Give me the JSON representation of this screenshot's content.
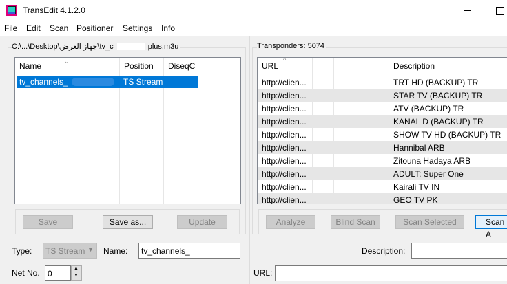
{
  "window": {
    "title": "TransEdit 4.1.2.0"
  },
  "menu": [
    "File",
    "Edit",
    "Scan",
    "Positioner",
    "Settings",
    "Info"
  ],
  "left_panel": {
    "path": "C:\\...\\Desktop\\جهاز العرض\\tv_c",
    "path_suffix": "plus.m3u",
    "columns": [
      "Name",
      "Position",
      "DiseqC"
    ],
    "rows": [
      {
        "name": "tv_channels_",
        "position": "TS Stream",
        "diseqc": ""
      }
    ],
    "buttons": {
      "save": "Save",
      "save_as": "Save as...",
      "update": "Update"
    },
    "type_label": "Type:",
    "type_value": "TS Stream",
    "name_label": "Name:",
    "name_value": "tv_channels_",
    "netno_label": "Net No.",
    "netno_value": "0"
  },
  "right_panel": {
    "label": "Transponders: 5074",
    "columns": [
      "URL",
      "Description"
    ],
    "rows": [
      {
        "url": "http://clien...",
        "desc": "TRT HD (BACKUP) TR"
      },
      {
        "url": "http://clien...",
        "desc": "STAR TV (BACKUP) TR"
      },
      {
        "url": "http://clien...",
        "desc": "ATV (BACKUP) TR"
      },
      {
        "url": "http://clien...",
        "desc": "KANAL D (BACKUP) TR"
      },
      {
        "url": "http://clien...",
        "desc": "SHOW TV HD (BACKUP) TR"
      },
      {
        "url": "http://clien...",
        "desc": "Hannibal ARB"
      },
      {
        "url": "http://clien...",
        "desc": "Zitouna Hadaya ARB"
      },
      {
        "url": "http://clien...",
        "desc": "ADULT: Super One"
      },
      {
        "url": "http://clien...",
        "desc": "Kairali TV IN"
      },
      {
        "url": "http://clien...",
        "desc": "GEO TV PK"
      }
    ],
    "buttons": {
      "analyze": "Analyze",
      "blind_scan": "Blind Scan",
      "scan_selected": "Scan Selected",
      "scan_all": "Scan A"
    },
    "description_label": "Description:",
    "url_label": "URL:"
  }
}
